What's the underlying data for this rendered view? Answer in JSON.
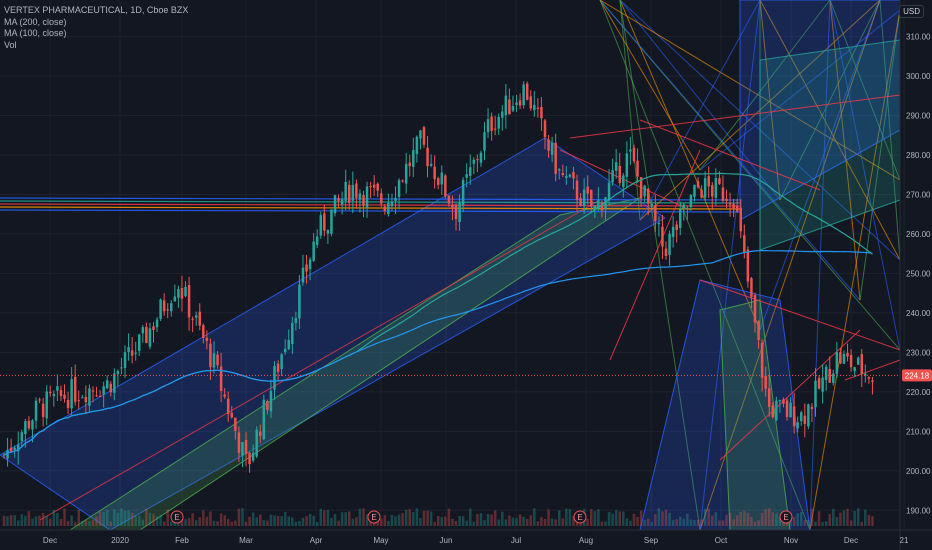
{
  "legend": {
    "title": "VERTEX PHARMACEUTICAL, 1D, Cboe BZX",
    "ma200": "MA (200, close)",
    "ma100": "MA (100, close)",
    "vol": "Vol"
  },
  "currency": "USD",
  "price_badge": "224.18",
  "earnings_marker": "E",
  "colors": {
    "background": "#131722",
    "up": "#26a69a",
    "down": "#ef5350",
    "ma200": "#2196f3",
    "ma100": "#26a69a",
    "channel_blue": "#2962ff",
    "channel_green": "#4caf50",
    "fib_red": "#f23645",
    "price_badge_bg": "#ef5350"
  },
  "chart_data": {
    "type": "candlestick",
    "title": "VERTEX PHARMACEUTICAL, 1D, Cboe BZX",
    "xlabel": "",
    "ylabel": "USD",
    "ylim": [
      185,
      318
    ],
    "y_ticks": [
      190,
      200,
      210,
      220,
      230,
      240,
      250,
      260,
      270,
      280,
      290,
      300,
      310
    ],
    "x_ticks": [
      "Dec",
      "2020",
      "Feb",
      "Mar",
      "Apr",
      "May",
      "Jun",
      "Jul",
      "Aug",
      "Sep",
      "Oct",
      "Nov",
      "Dec",
      "21"
    ],
    "last_price": 224.18,
    "approx_close_path": [
      {
        "date": "Dec",
        "close": 204
      },
      {
        "date": "mid-Dec",
        "close": 216
      },
      {
        "date": "2020",
        "close": 220
      },
      {
        "date": "mid-Jan",
        "close": 222
      },
      {
        "date": "Feb",
        "close": 233
      },
      {
        "date": "mid-Feb",
        "close": 248
      },
      {
        "date": "Mar",
        "close": 228
      },
      {
        "date": "mid-Mar",
        "close": 201
      },
      {
        "date": "Apr",
        "close": 230
      },
      {
        "date": "mid-Apr",
        "close": 260
      },
      {
        "date": "May",
        "close": 272
      },
      {
        "date": "mid-May",
        "close": 268
      },
      {
        "date": "Jun",
        "close": 283
      },
      {
        "date": "mid-Jun",
        "close": 266
      },
      {
        "date": "Jul",
        "close": 288
      },
      {
        "date": "mid-Jul",
        "close": 297
      },
      {
        "date": "Aug",
        "close": 275
      },
      {
        "date": "mid-Aug",
        "close": 266
      },
      {
        "date": "Sep",
        "close": 280
      },
      {
        "date": "mid-Sep",
        "close": 256
      },
      {
        "date": "Oct",
        "close": 272
      },
      {
        "date": "mid-Oct",
        "close": 270
      },
      {
        "date": "Nov",
        "close": 216
      },
      {
        "date": "mid-Nov",
        "close": 214
      },
      {
        "date": "Dec",
        "close": 229
      },
      {
        "date": "late-Dec",
        "close": 224.18
      }
    ],
    "series": [
      {
        "name": "MA (200, close)"
      },
      {
        "name": "MA (100, close)"
      },
      {
        "name": "Vol"
      }
    ],
    "annotations": [
      "E",
      "E",
      "E",
      "E"
    ],
    "grid": true,
    "legend_position": "top-left"
  }
}
